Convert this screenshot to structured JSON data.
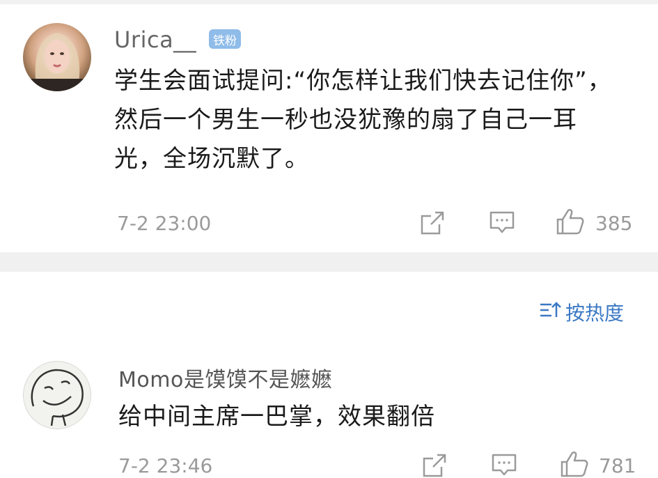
{
  "comments": [
    {
      "username": "Urica__",
      "badge": "铁粉",
      "text": "学生会面试提问:“你怎样让我们快去记住你”，然后一个男生一秒也没犹豫的扇了自己一耳光，全场沉默了。",
      "time": "7-2 23:00",
      "likes": "385"
    },
    {
      "username": "Momo是馍馍不是嬷嬷",
      "text": "给中间主席一巴掌，效果翻倍",
      "time": "7-2 23:46",
      "likes": "781"
    }
  ],
  "sort": {
    "label": "按热度"
  },
  "icons": {
    "share": "share-icon",
    "comment": "comment-icon",
    "like": "thumbs-up-icon",
    "sort": "sort-icon"
  },
  "colors": {
    "accent": "#3b78c4",
    "badge": "#8fbce9",
    "meta": "#9a9a9a"
  }
}
